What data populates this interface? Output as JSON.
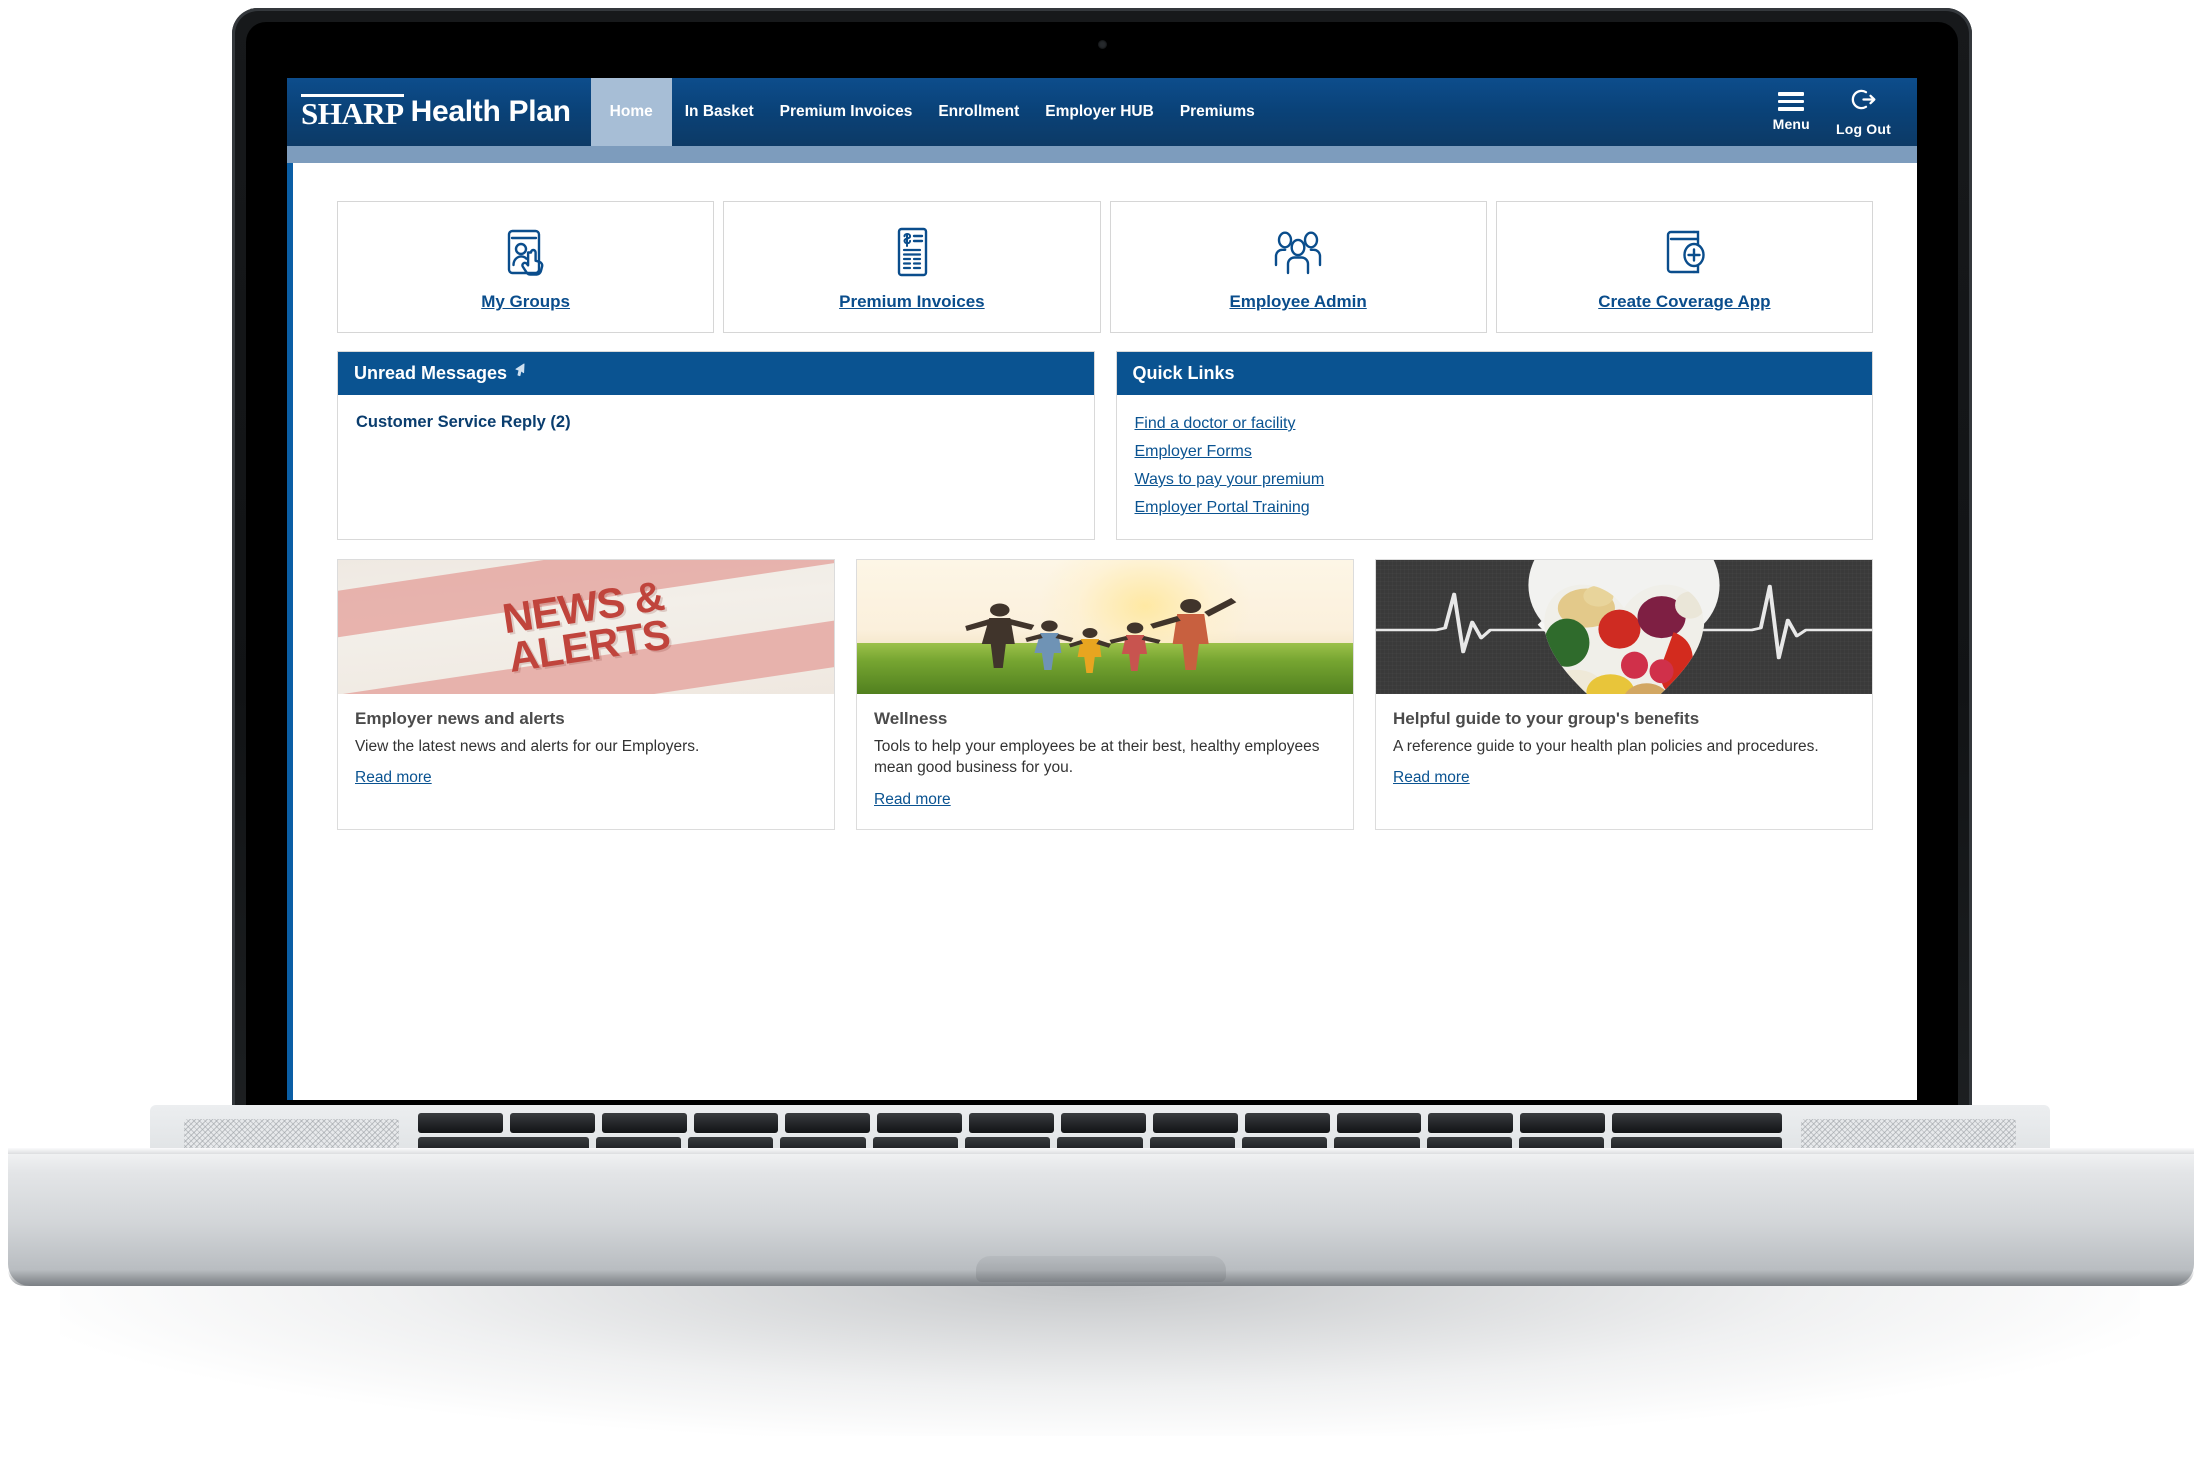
{
  "header": {
    "brand_sharp": "SHARP",
    "brand_rest": "Health Plan",
    "nav": [
      {
        "label": "Home",
        "active": true
      },
      {
        "label": "In Basket",
        "active": false
      },
      {
        "label": "Premium Invoices",
        "active": false
      },
      {
        "label": "Enrollment",
        "active": false
      },
      {
        "label": "Employer HUB",
        "active": false
      },
      {
        "label": "Premiums",
        "active": false
      }
    ],
    "menu_label": "Menu",
    "menu_icon": "hamburger-icon",
    "logout_label": "Log Out",
    "logout_icon": "logout-arrow-icon",
    "bar_color": "#0a4278",
    "subbar_color": "#7d9cbd",
    "active_tab_color": "#a7bed6"
  },
  "tiles": [
    {
      "label": "My Groups",
      "icon": "id-card-person-tap-icon"
    },
    {
      "label": "Premium Invoices",
      "icon": "invoice-dollar-icon"
    },
    {
      "label": "Employee Admin",
      "icon": "people-group-icon"
    },
    {
      "label": "Create Coverage App",
      "icon": "card-plus-icon"
    }
  ],
  "unread_messages": {
    "title": "Unread Messages",
    "title_glyph": "cursor-arrow-icon",
    "items": [
      {
        "label": "Customer Service Reply (2)"
      }
    ]
  },
  "quick_links": {
    "title": "Quick Links",
    "links": [
      {
        "label": "Find a doctor or facility"
      },
      {
        "label": "Employer Forms"
      },
      {
        "label": "Ways to pay your premium"
      },
      {
        "label": "Employer Portal Training"
      }
    ]
  },
  "cards": [
    {
      "image": "news-and-alerts-banner",
      "image_text_line1": "NEWS &",
      "image_text_line2": "ALERTS",
      "title": "Employer news and alerts",
      "desc": "View the latest news and alerts for our Employers.",
      "link": "Read more"
    },
    {
      "image": "family-running-field-photo",
      "title": "Wellness",
      "desc": "Tools to help your employees be at their best, healthy employees mean good business for you.",
      "link": "Read more"
    },
    {
      "image": "heart-vegetables-ecg-photo",
      "title": "Helpful guide to your group's benefits",
      "desc": "A reference guide to your health plan policies and procedures.",
      "link": "Read more"
    }
  ],
  "colors": {
    "brand_blue": "#0a4278",
    "panel_header_blue": "#0a5391",
    "link_blue": "#0a5391",
    "rail_blue": "#0a5ea5",
    "news_red": "#c0443c"
  }
}
